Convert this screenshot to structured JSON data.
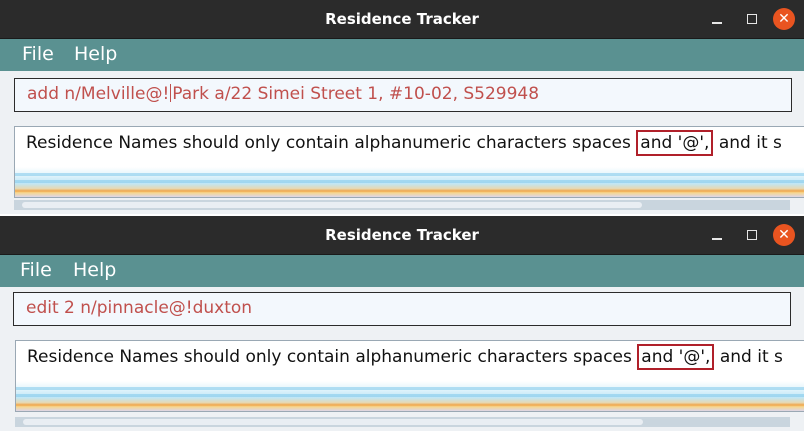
{
  "windows": [
    {
      "title": "Residence Tracker",
      "menu": [
        "File",
        "Help"
      ],
      "command": {
        "before_caret": "add n/Melville@!",
        "after_caret": "Park a/22 Simei Street 1, #10-02, S529948"
      },
      "result": {
        "before": "Residence Names should only contain alphanumeric characters spaces ",
        "highlighted": "and '@',",
        "after": " and it s"
      }
    },
    {
      "title": "Residence Tracker",
      "menu": [
        "File",
        "Help"
      ],
      "command": {
        "before_caret": "edit 2 n/pinnacle@!duxton",
        "after_caret": ""
      },
      "result": {
        "before": "Residence Names should only contain alphanumeric characters spaces ",
        "highlighted": "and '@',",
        "after": " and it s"
      }
    }
  ],
  "colors": {
    "titlebar": "#2b2b2b",
    "menubar": "#5a9191",
    "command_text": "#c0504d",
    "close_button": "#e95420",
    "highlight_box": "#b0202a"
  },
  "icons": [
    "minimize-icon",
    "maximize-icon",
    "close-icon"
  ]
}
